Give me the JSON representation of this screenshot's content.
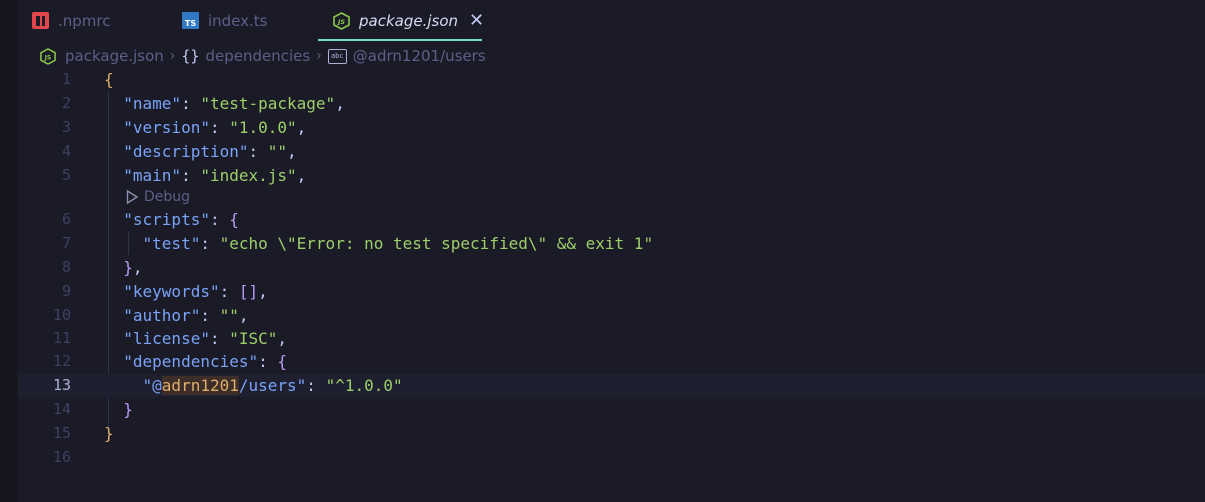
{
  "tabs": [
    {
      "label": ".npmrc",
      "icon": "npm-icon",
      "active": false
    },
    {
      "label": "index.ts",
      "icon": "typescript-icon",
      "active": false
    },
    {
      "label": "package.json",
      "icon": "nodejs-icon",
      "active": true,
      "close": "✕"
    }
  ],
  "breadcrumb": {
    "file": "package.json",
    "object_glyph": "{}",
    "object": "dependencies",
    "key_glyph": "abc",
    "key": "@adrn1201/users"
  },
  "codelens": {
    "label": "Debug"
  },
  "line_numbers": [
    "1",
    "2",
    "3",
    "4",
    "5",
    "6",
    "7",
    "8",
    "9",
    "10",
    "11",
    "12",
    "13",
    "14",
    "15",
    "16"
  ],
  "code": {
    "name_key": "\"name\"",
    "name_val": "\"test-package\"",
    "version_key": "\"version\"",
    "version_val": "\"1.0.0\"",
    "description_key": "\"description\"",
    "description_val": "\"\"",
    "main_key": "\"main\"",
    "main_val": "\"index.js\"",
    "scripts_key": "\"scripts\"",
    "test_key": "\"test\"",
    "test_val": "\"echo \\\"Error: no test specified\\\" && exit 1\"",
    "keywords_key": "\"keywords\"",
    "author_key": "\"author\"",
    "author_val": "\"\"",
    "license_key": "\"license\"",
    "license_val": "\"ISC\"",
    "dependencies_key": "\"dependencies\"",
    "dep_quote_open": "\"@",
    "dep_scope_highlight": "adrn1201",
    "dep_rest": "/users\"",
    "dep_val": "\"^1.0.0\""
  },
  "colors": {
    "accent_underline": "#73daca",
    "keys": "#7aa2f7",
    "strings": "#9ece6a",
    "braces": "#e0af68"
  }
}
